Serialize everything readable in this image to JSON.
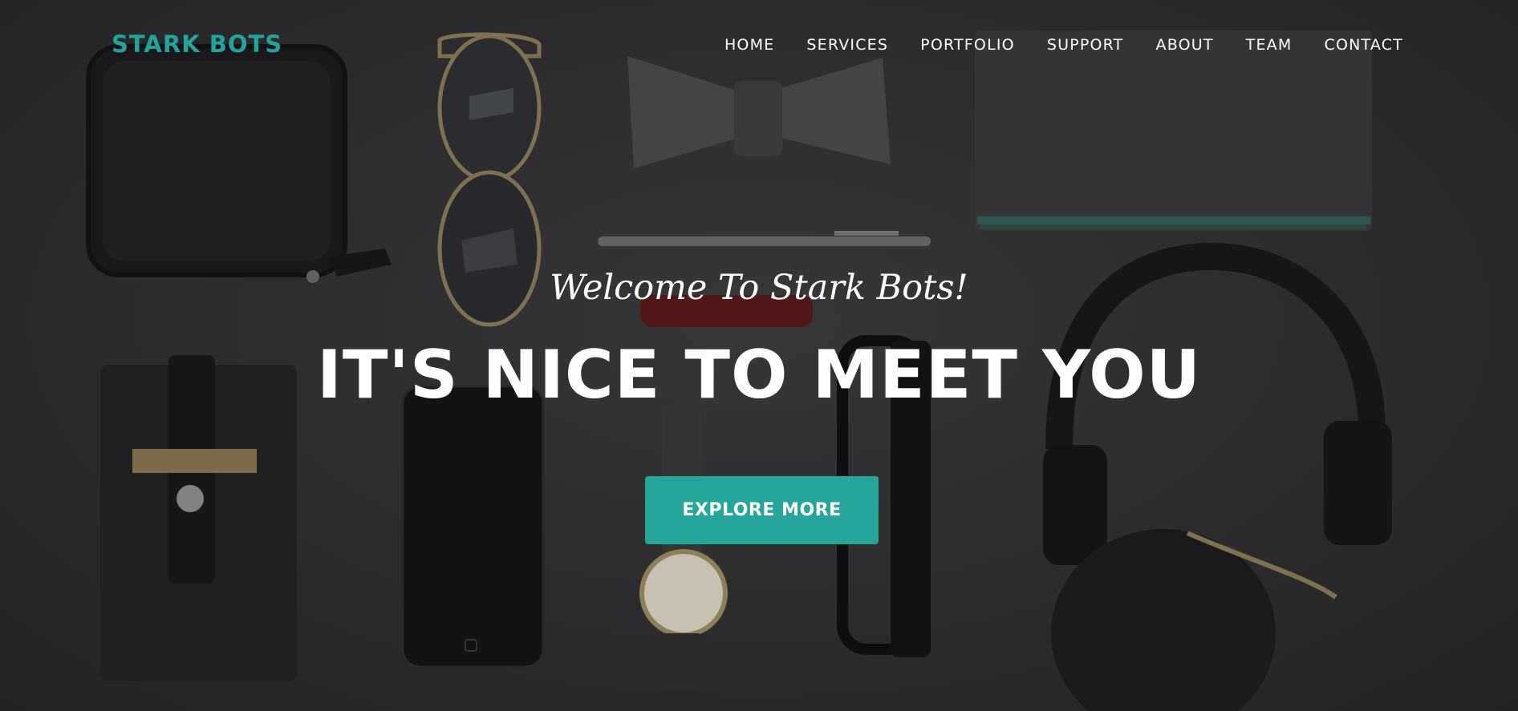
{
  "brand": {
    "name": "STARK BOTS"
  },
  "nav": {
    "items": [
      {
        "label": "HOME"
      },
      {
        "label": "SERVICES"
      },
      {
        "label": "PORTFOLIO"
      },
      {
        "label": "SUPPORT"
      },
      {
        "label": "ABOUT"
      },
      {
        "label": "TEAM"
      },
      {
        "label": "CONTACT"
      }
    ]
  },
  "hero": {
    "subheading": "Welcome To Stark Bots!",
    "heading": "IT'S NICE TO MEET YOU",
    "cta_label": "EXPLORE MORE"
  },
  "colors": {
    "accent": "#26a69a",
    "brand": "#24a39c",
    "text": "#ffffff",
    "background": "#2f2f31"
  }
}
